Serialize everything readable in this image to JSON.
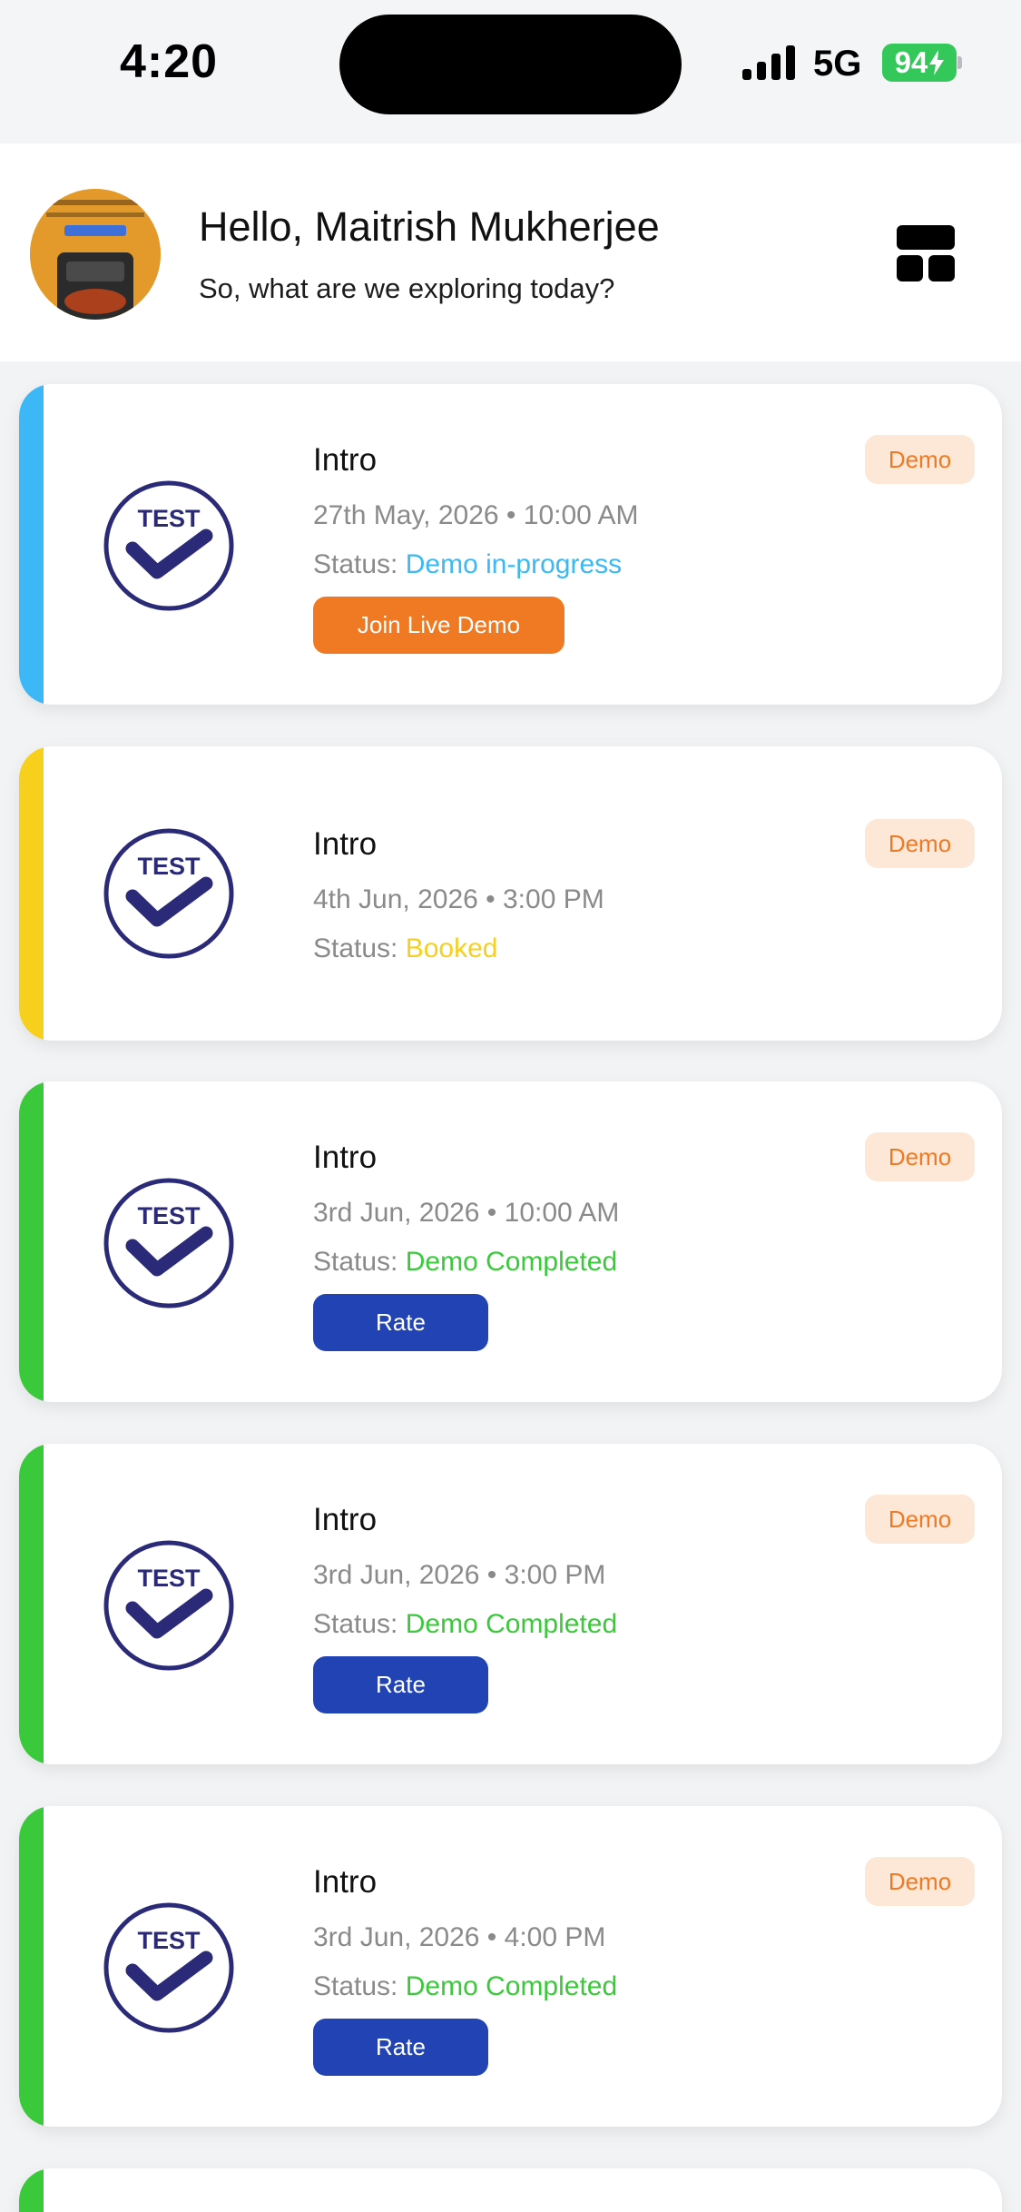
{
  "status_bar": {
    "time": "4:20",
    "network": "5G",
    "battery": "94"
  },
  "header": {
    "greeting": "Hello, Maitrish Mukherjee",
    "subtitle": "So, what are we exploring today?",
    "avatar_icon": "avatar",
    "menu_icon": "layout-grid-icon"
  },
  "logo_text": "TEST",
  "colors": {
    "in_progress": "#3bb8f5",
    "booked": "#f7cf1d",
    "completed": "#3ac93a",
    "badge_text": "#f07a23",
    "join_button": "#f07a23",
    "rate_button": "#2143b3"
  },
  "cards": [
    {
      "title": "Intro",
      "datetime": "27th May, 2026 • 10:00 AM",
      "status_label": "Status:",
      "status_value": "Demo in-progress",
      "badge": "Demo",
      "button": "Join Live Demo"
    },
    {
      "title": "Intro",
      "datetime": "4th Jun, 2026 • 3:00 PM",
      "status_label": "Status:",
      "status_value": "Booked",
      "badge": "Demo"
    },
    {
      "title": "Intro",
      "datetime": "3rd Jun, 2026 • 10:00 AM",
      "status_label": "Status:",
      "status_value": "Demo Completed",
      "badge": "Demo",
      "button": "Rate"
    },
    {
      "title": "Intro",
      "datetime": "3rd Jun, 2026 • 3:00 PM",
      "status_label": "Status:",
      "status_value": "Demo Completed",
      "badge": "Demo",
      "button": "Rate"
    },
    {
      "title": "Intro",
      "datetime": "3rd Jun, 2026 • 4:00 PM",
      "status_label": "Status:",
      "status_value": "Demo Completed",
      "badge": "Demo",
      "button": "Rate"
    }
  ]
}
